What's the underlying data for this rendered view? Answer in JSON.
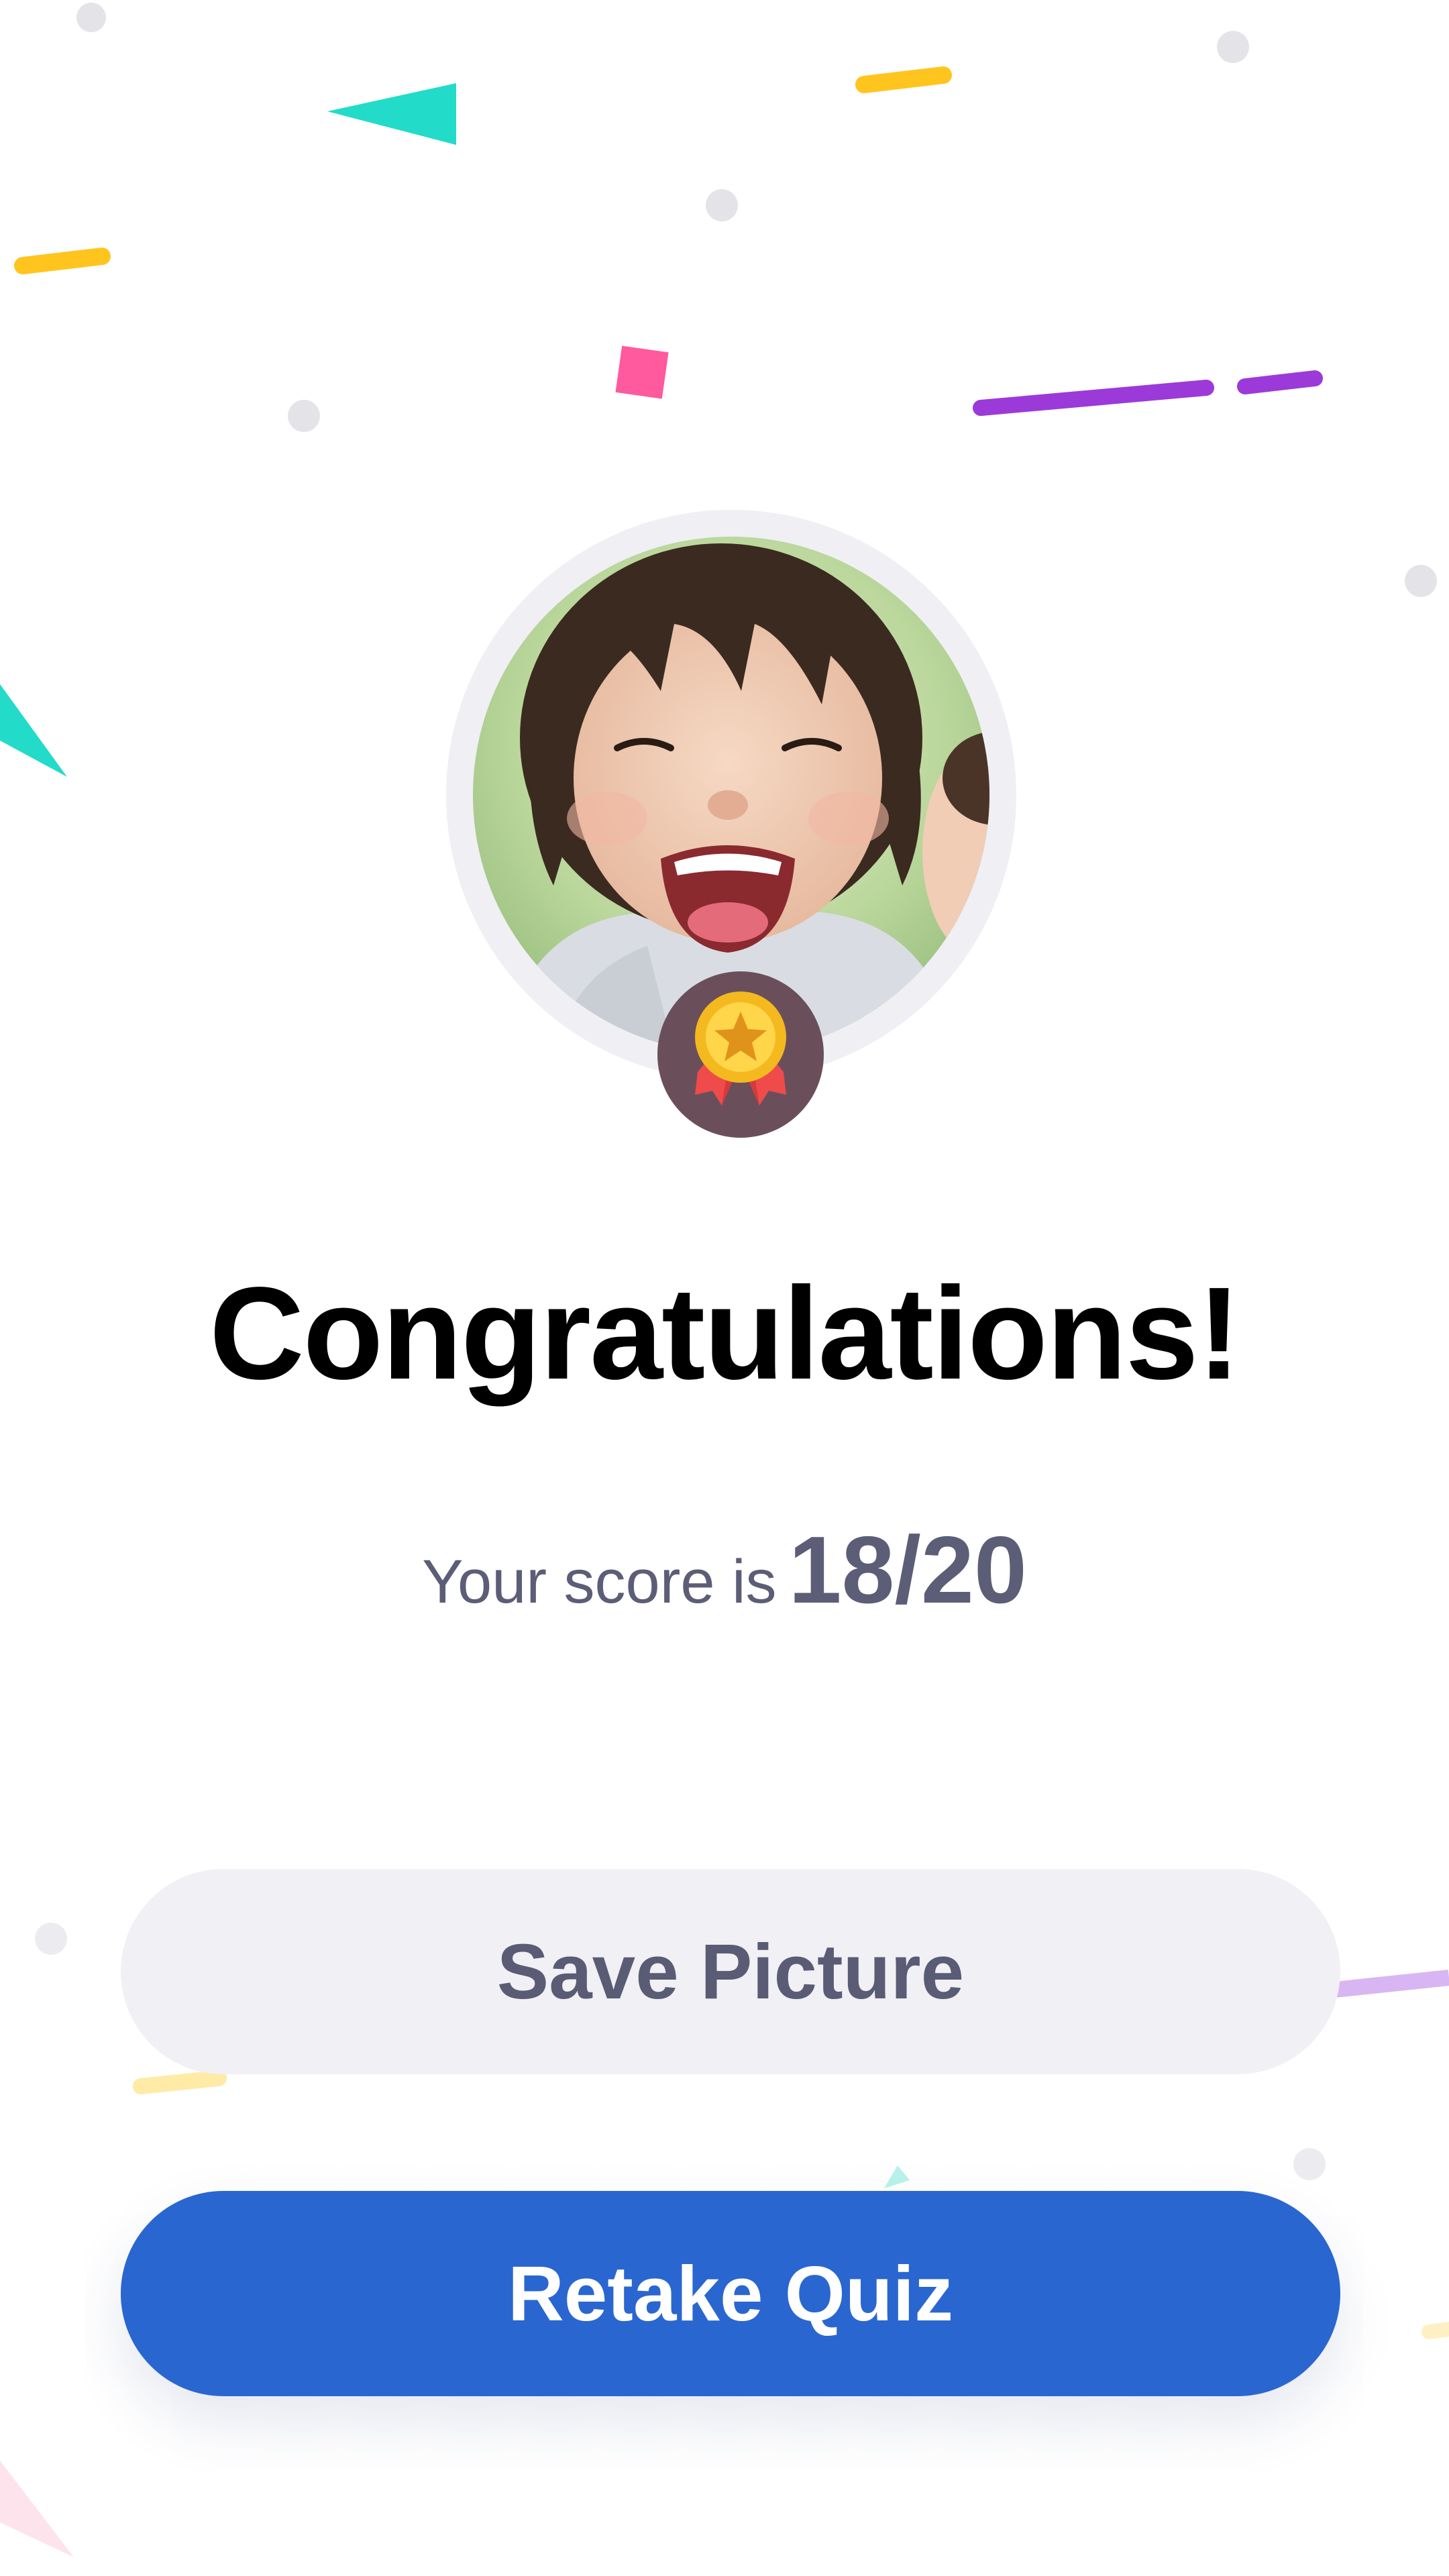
{
  "result": {
    "title": "Congratulations!",
    "score_label": "Your score is",
    "score_value": "18/20"
  },
  "avatar": {
    "photo": "smiling-child-photo",
    "badge_icon": "medal-icon"
  },
  "actions": {
    "save_label": "Save Picture",
    "retake_label": "Retake Quiz"
  },
  "colors": {
    "primary": "#2a66d0",
    "secondary_bg": "#f0f0f5",
    "secondary_text": "#5a5b74",
    "badge_bg": "#6a4f5b",
    "confetti_teal": "#22dbc9",
    "confetti_yellow": "#ffc51e",
    "confetti_purple": "#9b3ad9",
    "confetti_pink": "#ff5a9d"
  }
}
